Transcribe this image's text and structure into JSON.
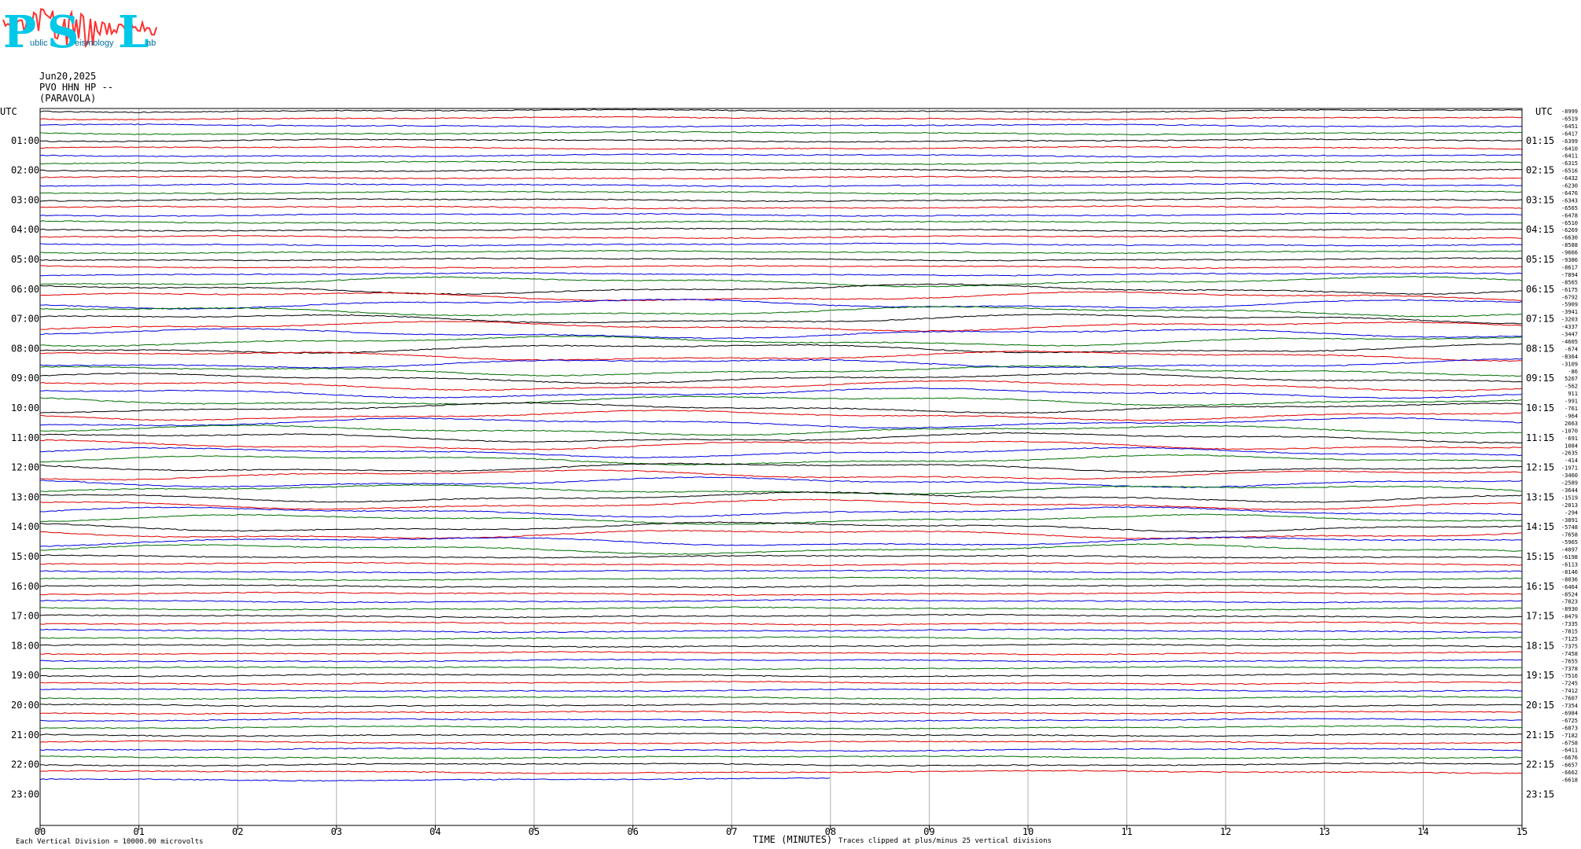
{
  "logo": {
    "letters": [
      "P",
      "S",
      "L"
    ],
    "words": [
      "ublic",
      "eismology",
      "ab"
    ],
    "color_letters": "#00c8e8",
    "color_wave": "#ff3030"
  },
  "header": {
    "date": "Jun20,2025",
    "station": "PVO HHN HP --",
    "location": "(PARAVOLA)"
  },
  "chart_data": {
    "type": "line",
    "title": "",
    "xlabel": "TIME (MINUTES)",
    "x_ticks": [
      "00",
      "01",
      "02",
      "03",
      "04",
      "05",
      "06",
      "07",
      "08",
      "09",
      "10",
      "11",
      "12",
      "13",
      "14",
      "15"
    ],
    "xlim": [
      0,
      15
    ],
    "left_axis_title": "UTC",
    "right_axis_title": "UTC",
    "left_time_labels": [
      "01:00",
      "02:00",
      "03:00",
      "04:00",
      "05:00",
      "06:00",
      "07:00",
      "08:00",
      "09:00",
      "10:00",
      "11:00",
      "12:00",
      "13:00",
      "14:00",
      "15:00",
      "16:00",
      "17:00",
      "18:00",
      "19:00",
      "20:00",
      "21:00",
      "22:00",
      "23:00"
    ],
    "right_time_labels": [
      "01:15",
      "02:15",
      "03:15",
      "04:15",
      "05:15",
      "06:15",
      "07:15",
      "08:15",
      "09:15",
      "10:15",
      "11:15",
      "12:15",
      "13:15",
      "14:15",
      "15:15",
      "16:15",
      "17:15",
      "18:15",
      "19:15",
      "20:15",
      "21:15",
      "22:15",
      "23:15"
    ],
    "trace_offsets": [
      "-8999",
      "-6519",
      "-6451",
      "-6417",
      "-6399",
      "-6410",
      "-6411",
      "-6315",
      "-6516",
      "-6432",
      "-6230",
      "-6476",
      "-6343",
      "-6565",
      "-6478",
      "-6510",
      "-6269",
      "-6630",
      "-8588",
      "-9666",
      "-9386",
      "-8617",
      "-7894",
      "-8565",
      "-6175",
      "-6792",
      "-5909",
      "-3941",
      "-3203",
      "-4337",
      "-3447",
      "-4605",
      "-674",
      "-8364",
      "-3109",
      "-86",
      "5267",
      "-562",
      "911",
      "-991",
      "-761",
      "-964",
      "2663",
      "-1070",
      "-691",
      "1084",
      "-2635",
      "-414",
      "-1971",
      "-3460",
      "-2589",
      "-3644",
      "-1519",
      "-2013",
      "-294",
      "-3891",
      "-5748",
      "-7658",
      "-5965",
      "-4097",
      "-6198",
      "-6113",
      "-8146",
      "-8036",
      "-6464",
      "-8524",
      "-7823",
      "-8930",
      "-8479",
      "-7335",
      "-7815",
      "-7125",
      "-7375",
      "-7458",
      "-7655",
      "-7378",
      "-7516",
      "-7245",
      "-7412",
      "-7607",
      "-7354",
      "-6984",
      "-6725",
      "-6873",
      "-7182",
      "-6758",
      "-6411",
      "-6676",
      "-6657",
      "-6662",
      "-6618"
    ],
    "trace_colors": [
      "#000000",
      "#e00000",
      "#0000e0",
      "#007000"
    ],
    "trace_minutes_per_line": 15,
    "last_trace_end_minute": 8.0,
    "vertical_division": "Each Vertical Division = 10000.00 microvolts",
    "clip_note": "Traces clipped at plus/minus 25 vertical divisions",
    "grid": true
  }
}
